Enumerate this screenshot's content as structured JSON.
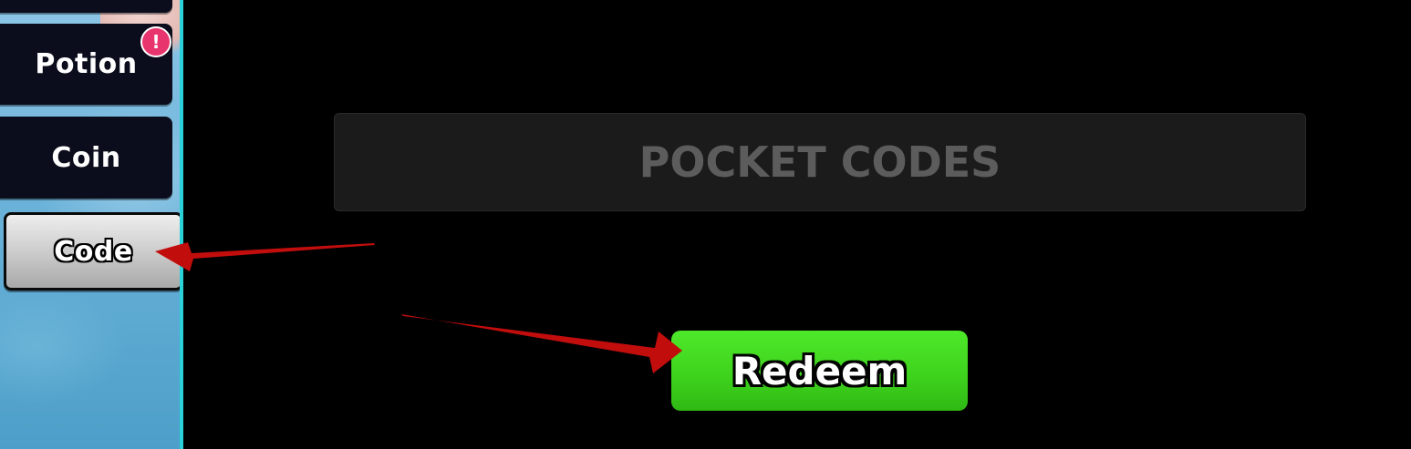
{
  "sidebar": {
    "tabs": [
      {
        "label": "Potion",
        "has_alert": true,
        "alert_glyph": "!"
      },
      {
        "label": "Coin",
        "has_alert": false
      },
      {
        "label": "Code",
        "selected": true
      }
    ]
  },
  "codes_panel": {
    "input_placeholder": "POCKET CODES",
    "input_value": "",
    "redeem_label": "Redeem"
  },
  "annotations": {
    "arrow_color": "#c20d0d",
    "arrows": [
      "arrow-to-code-tab",
      "arrow-to-redeem-button"
    ]
  },
  "colors": {
    "background": "#000000",
    "redeem_green": "#3dd11c",
    "alert_pink": "#e8356e",
    "sidebar_edge": "#2ad1d8"
  }
}
